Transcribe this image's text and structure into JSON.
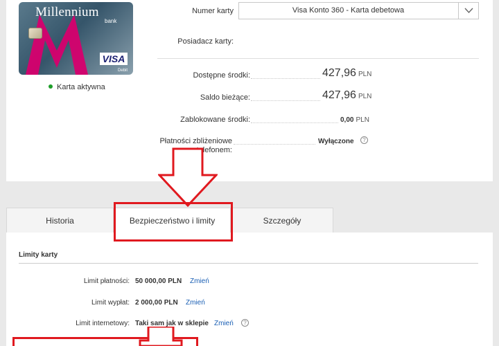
{
  "card": {
    "brand": "Millennium",
    "bank": "bank",
    "network": "VISA",
    "network_sub": "Debit",
    "status": "Karta aktywna",
    "status_color": "#1e9e2a"
  },
  "details": {
    "card_number_label": "Numer karty",
    "card_select_value": "Visa Konto 360 - Karta debetowa",
    "holder_label": "Posiadacz karty:",
    "available_label": "Dostępne środki:",
    "available_value": "427,96",
    "balance_label": "Saldo bieżące:",
    "balance_value": "427,96",
    "blocked_label": "Zablokowane środki:",
    "blocked_value": "0,00",
    "contactless_label_line1": "Płatności zbliżeniowe",
    "contactless_label_line2": "telefonem:",
    "contactless_value": "Wyłączone",
    "currency": "PLN"
  },
  "tabs": [
    {
      "label": "Historia"
    },
    {
      "label": "Bezpieczeństwo i limity"
    },
    {
      "label": "Szczegóły"
    }
  ],
  "limits": {
    "section_title": "Limity karty",
    "payment_label": "Limit płatności:",
    "payment_value": "50 000,00 PLN",
    "withdrawal_label": "Limit wypłat:",
    "withdrawal_value": "2 000,00 PLN",
    "internet_label": "Limit internetowy:",
    "internet_value": "Taki sam jak w sklepie",
    "change_link": "Zmień"
  },
  "colors": {
    "accent_red": "#e0191f",
    "link_blue": "#1a5fb4",
    "brand_magenta": "#d6006e"
  }
}
